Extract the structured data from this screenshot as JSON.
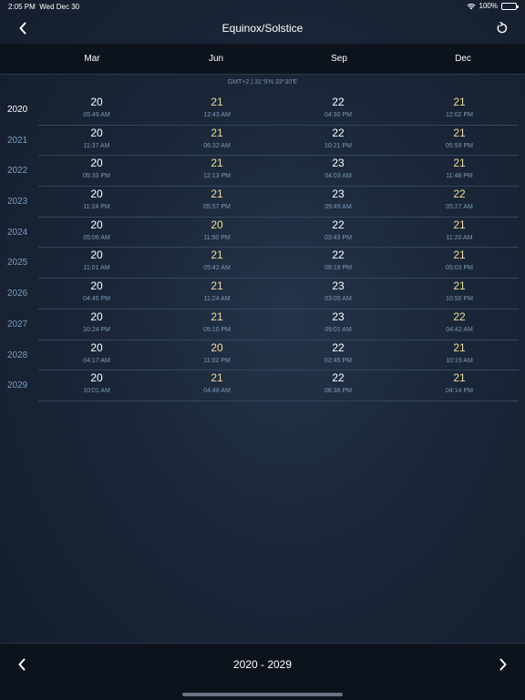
{
  "status_bar": {
    "time": "2:05 PM",
    "date": "Wed Dec 30",
    "battery": "100%",
    "battery_level": 1.0,
    "icons": [
      "wifi-icon",
      "battery-icon"
    ]
  },
  "nav": {
    "title": "Equinox/Solstice",
    "back_icon": "chevron-left-icon",
    "refresh_icon": "refresh-icon"
  },
  "columns": [
    "Mar",
    "Jun",
    "Sep",
    "Dec"
  ],
  "timezone": "GMT+2 | 31°9'N 33°30'E",
  "colors": {
    "equinox": "#ffffff",
    "solstice": "#f0dca0",
    "year": "#7d9ec2",
    "current_year": "#ffffff",
    "time": "#7d9ab8"
  },
  "rows": [
    {
      "year": "2020",
      "current": true,
      "cells": [
        {
          "day": "20",
          "time": "05:49 AM"
        },
        {
          "day": "21",
          "time": "12:43 AM"
        },
        {
          "day": "22",
          "time": "04:30 PM"
        },
        {
          "day": "21",
          "time": "12:02 PM"
        }
      ]
    },
    {
      "year": "2021",
      "current": false,
      "cells": [
        {
          "day": "20",
          "time": "11:37 AM"
        },
        {
          "day": "21",
          "time": "06:32 AM"
        },
        {
          "day": "22",
          "time": "10:21 PM"
        },
        {
          "day": "21",
          "time": "05:59 PM"
        }
      ]
    },
    {
      "year": "2022",
      "current": false,
      "cells": [
        {
          "day": "20",
          "time": "05:33 PM"
        },
        {
          "day": "21",
          "time": "12:13 PM"
        },
        {
          "day": "23",
          "time": "04:03 AM"
        },
        {
          "day": "21",
          "time": "11:48 PM"
        }
      ]
    },
    {
      "year": "2023",
      "current": false,
      "cells": [
        {
          "day": "20",
          "time": "11:24 PM"
        },
        {
          "day": "21",
          "time": "05:57 PM"
        },
        {
          "day": "23",
          "time": "09:49 AM"
        },
        {
          "day": "22",
          "time": "05:27 AM"
        }
      ]
    },
    {
      "year": "2024",
      "current": false,
      "cells": [
        {
          "day": "20",
          "time": "05:06 AM"
        },
        {
          "day": "20",
          "time": "11:50 PM"
        },
        {
          "day": "22",
          "time": "03:43 PM"
        },
        {
          "day": "21",
          "time": "11:20 AM"
        }
      ]
    },
    {
      "year": "2025",
      "current": false,
      "cells": [
        {
          "day": "20",
          "time": "11:01 AM"
        },
        {
          "day": "21",
          "time": "05:42 AM"
        },
        {
          "day": "22",
          "time": "09:19 PM"
        },
        {
          "day": "21",
          "time": "05:03 PM"
        }
      ]
    },
    {
      "year": "2026",
      "current": false,
      "cells": [
        {
          "day": "20",
          "time": "04:45 PM"
        },
        {
          "day": "21",
          "time": "11:24 AM"
        },
        {
          "day": "23",
          "time": "03:05 AM"
        },
        {
          "day": "21",
          "time": "10:50 PM"
        }
      ]
    },
    {
      "year": "2027",
      "current": false,
      "cells": [
        {
          "day": "20",
          "time": "10:24 PM"
        },
        {
          "day": "21",
          "time": "05:10 PM"
        },
        {
          "day": "23",
          "time": "09:01 AM"
        },
        {
          "day": "22",
          "time": "04:42 AM"
        }
      ]
    },
    {
      "year": "2028",
      "current": false,
      "cells": [
        {
          "day": "20",
          "time": "04:17 AM"
        },
        {
          "day": "20",
          "time": "11:02 PM"
        },
        {
          "day": "22",
          "time": "02:45 PM"
        },
        {
          "day": "21",
          "time": "10:19 AM"
        }
      ]
    },
    {
      "year": "2029",
      "current": false,
      "cells": [
        {
          "day": "20",
          "time": "10:01 AM"
        },
        {
          "day": "21",
          "time": "04:48 AM"
        },
        {
          "day": "22",
          "time": "08:38 PM"
        },
        {
          "day": "21",
          "time": "04:14 PM"
        }
      ]
    }
  ],
  "footer": {
    "range": "2020 - 2029",
    "prev_icon": "chevron-left-icon",
    "next_icon": "chevron-right-icon"
  }
}
